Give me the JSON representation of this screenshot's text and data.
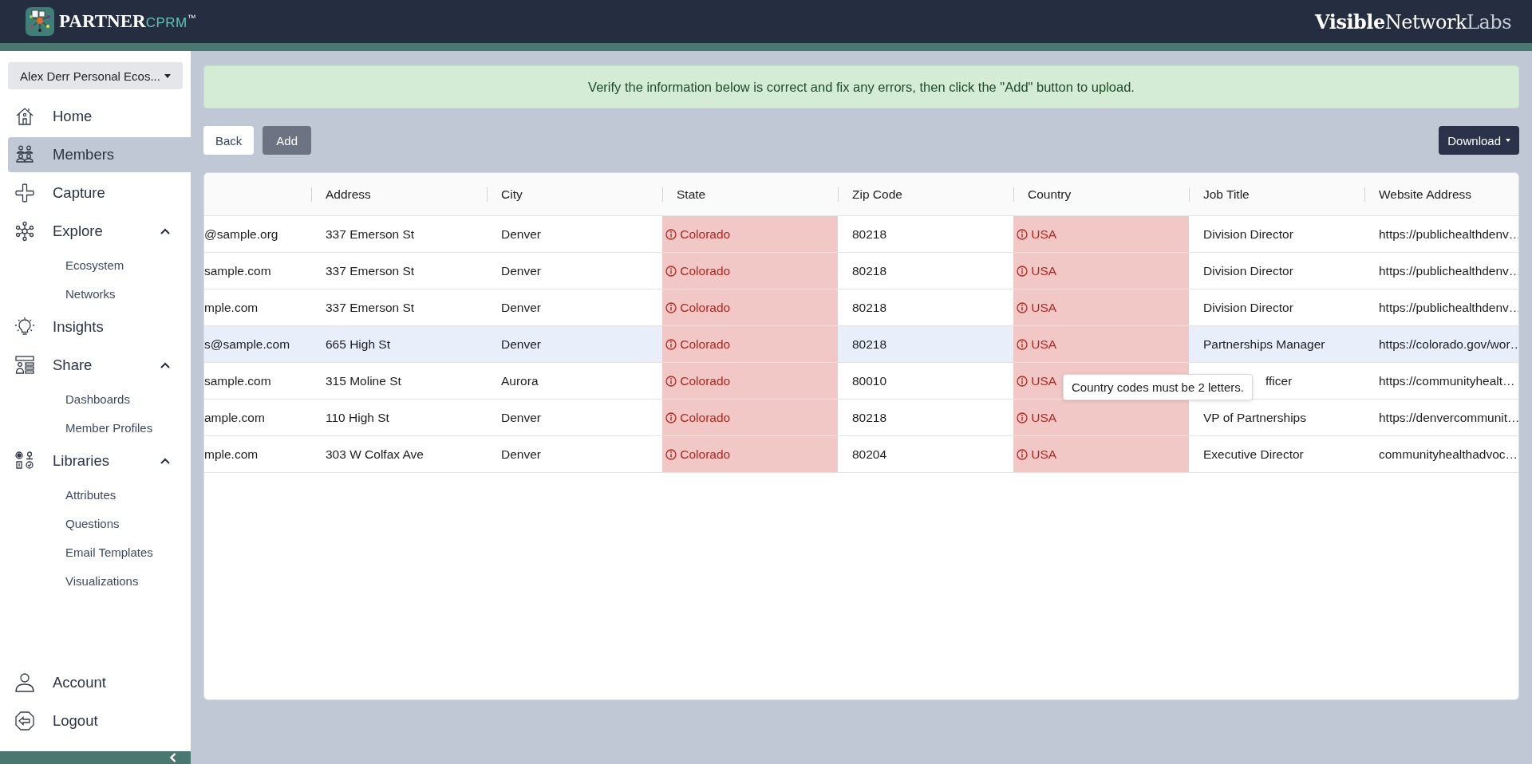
{
  "header": {
    "logo": {
      "name": "PARTNER",
      "suffix": "CPRM",
      "mark": "™"
    },
    "brand": {
      "bold": "Visible",
      "regular": "Network",
      "light": "Labs"
    }
  },
  "sidebar": {
    "ecosystem_select": "Alex Derr Personal Ecos...",
    "items": [
      {
        "label": "Home",
        "selected": false
      },
      {
        "label": "Members",
        "selected": true
      },
      {
        "label": "Capture",
        "selected": false
      },
      {
        "label": "Explore",
        "selected": false,
        "expanded": true,
        "children": [
          {
            "label": "Ecosystem",
            "selected": false
          },
          {
            "label": "Networks",
            "selected": false
          }
        ]
      },
      {
        "label": "Insights",
        "selected": false
      },
      {
        "label": "Share",
        "selected": false,
        "expanded": true,
        "children": [
          {
            "label": "Dashboards",
            "selected": false
          },
          {
            "label": "Member Profiles",
            "selected": false
          }
        ]
      },
      {
        "label": "Libraries",
        "selected": false,
        "expanded": true,
        "children": [
          {
            "label": "Attributes",
            "selected": false
          },
          {
            "label": "Questions",
            "selected": false
          },
          {
            "label": "Email Templates",
            "selected": false
          },
          {
            "label": "Visualizations",
            "selected": false
          }
        ]
      }
    ],
    "footer_items": [
      {
        "label": "Account",
        "selected": false
      },
      {
        "label": "Logout",
        "selected": false
      }
    ]
  },
  "banner": "Verify the information below is correct and fix any errors, then click the \"Add\" button to upload.",
  "buttons": [
    {
      "label": "Back",
      "kind": "light"
    },
    {
      "label": "Add",
      "kind": "secondary"
    }
  ],
  "download_button": "Download",
  "table": {
    "columns": [
      {
        "kind": "blank"
      },
      {
        "kind": "text",
        "label": "Address"
      },
      {
        "kind": "text",
        "label": "City"
      },
      {
        "kind": "text",
        "label": "State"
      },
      {
        "kind": "text",
        "label": "Zip Code"
      },
      {
        "kind": "text",
        "label": "Country"
      },
      {
        "kind": "text",
        "label": "Job Title"
      },
      {
        "kind": "text",
        "label": "Website Address"
      }
    ],
    "rows": [
      {
        "hovered": false,
        "cells": [
          {
            "text": "@sample.org",
            "error": false
          },
          {
            "text": "337 Emerson St",
            "error": false
          },
          {
            "text": "Denver",
            "error": false
          },
          {
            "text": "Colorado",
            "error": true
          },
          {
            "text": "80218",
            "error": false
          },
          {
            "text": "USA",
            "error": true
          },
          {
            "text": "Division Director",
            "error": false
          },
          {
            "text": "https://publichealthdenv…",
            "error": false
          }
        ]
      },
      {
        "hovered": false,
        "cells": [
          {
            "text": "sample.com",
            "error": false
          },
          {
            "text": "337 Emerson St",
            "error": false
          },
          {
            "text": "Denver",
            "error": false
          },
          {
            "text": "Colorado",
            "error": true
          },
          {
            "text": "80218",
            "error": false
          },
          {
            "text": "USA",
            "error": true
          },
          {
            "text": "Division Director",
            "error": false
          },
          {
            "text": "https://publichealthdenv…",
            "error": false
          }
        ]
      },
      {
        "hovered": false,
        "cells": [
          {
            "text": "mple.com",
            "error": false
          },
          {
            "text": "337 Emerson St",
            "error": false
          },
          {
            "text": "Denver",
            "error": false
          },
          {
            "text": "Colorado",
            "error": true
          },
          {
            "text": "80218",
            "error": false
          },
          {
            "text": "USA",
            "error": true
          },
          {
            "text": "Division Director",
            "error": false
          },
          {
            "text": "https://publichealthdenv…",
            "error": false
          }
        ]
      },
      {
        "hovered": true,
        "cells": [
          {
            "text": "s@sample.com",
            "error": false
          },
          {
            "text": "665 High St",
            "error": false
          },
          {
            "text": "Denver",
            "error": false
          },
          {
            "text": "Colorado",
            "error": true
          },
          {
            "text": "80218",
            "error": false
          },
          {
            "text": "USA",
            "error": true
          },
          {
            "text": "Partnerships Manager",
            "error": false
          },
          {
            "text": "https://colorado.gov/wor…",
            "error": false
          }
        ]
      },
      {
        "hovered": false,
        "cells": [
          {
            "text": "sample.com",
            "error": false
          },
          {
            "text": "315 Moline St",
            "error": false
          },
          {
            "text": "Aurora",
            "error": false
          },
          {
            "text": "Colorado",
            "error": true
          },
          {
            "text": "80010",
            "error": false
          },
          {
            "text": "USA",
            "error": true,
            "tooltip": "Country codes must be 2 letters."
          },
          {
            "text": "fficer",
            "error": false,
            "covered": true
          },
          {
            "text": "https://communityhealt…",
            "error": false
          }
        ]
      },
      {
        "hovered": false,
        "cells": [
          {
            "text": "ample.com",
            "error": false
          },
          {
            "text": "110 High St",
            "error": false
          },
          {
            "text": "Denver",
            "error": false
          },
          {
            "text": "Colorado",
            "error": true
          },
          {
            "text": "80218",
            "error": false
          },
          {
            "text": "USA",
            "error": true
          },
          {
            "text": "VP of Partnerships",
            "error": false
          },
          {
            "text": "https://denvercommunit…",
            "error": false
          }
        ]
      },
      {
        "hovered": false,
        "cells": [
          {
            "text": "mple.com",
            "error": false
          },
          {
            "text": "303 W Colfax Ave",
            "error": false
          },
          {
            "text": "Denver",
            "error": false
          },
          {
            "text": "Colorado",
            "error": true
          },
          {
            "text": "80204",
            "error": false
          },
          {
            "text": "USA",
            "error": true
          },
          {
            "text": "Executive Director",
            "error": false
          },
          {
            "text": "communityhealthadvoc…",
            "error": false
          }
        ]
      }
    ]
  }
}
